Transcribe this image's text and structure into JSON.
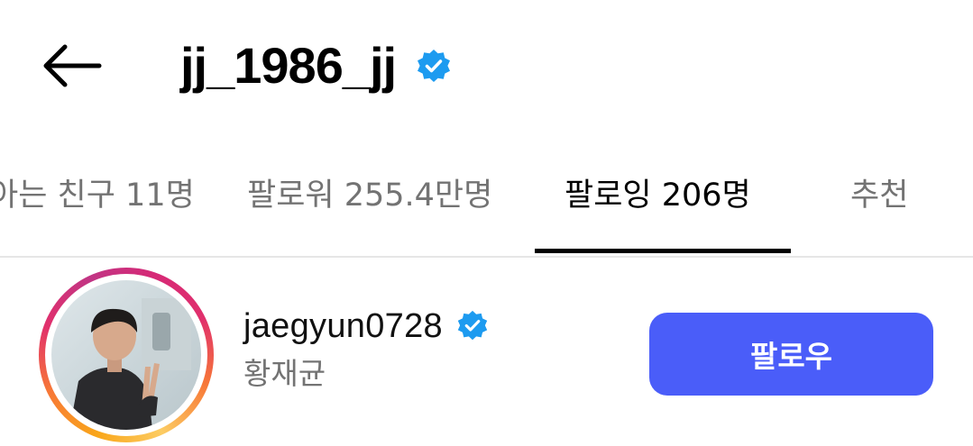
{
  "header": {
    "title": "jj_1986_jj",
    "verified_icon": "verified-badge-icon",
    "back_icon": "arrow-left-icon"
  },
  "tabs": [
    {
      "label": "아는 친구 11명",
      "active": false
    },
    {
      "label": "팔로워 255.4만명",
      "active": false
    },
    {
      "label": "팔로잉 206명",
      "active": true
    },
    {
      "label": "추천",
      "active": false
    }
  ],
  "list": [
    {
      "username": "jaegyun0728",
      "verified": true,
      "full_name": "황재균",
      "follow_label": "팔로우"
    }
  ],
  "colors": {
    "follow_button": "#4a5df9",
    "verified_badge": "#1d9bf0",
    "secondary_text": "#737373",
    "active_tab_indicator": "#000000"
  }
}
